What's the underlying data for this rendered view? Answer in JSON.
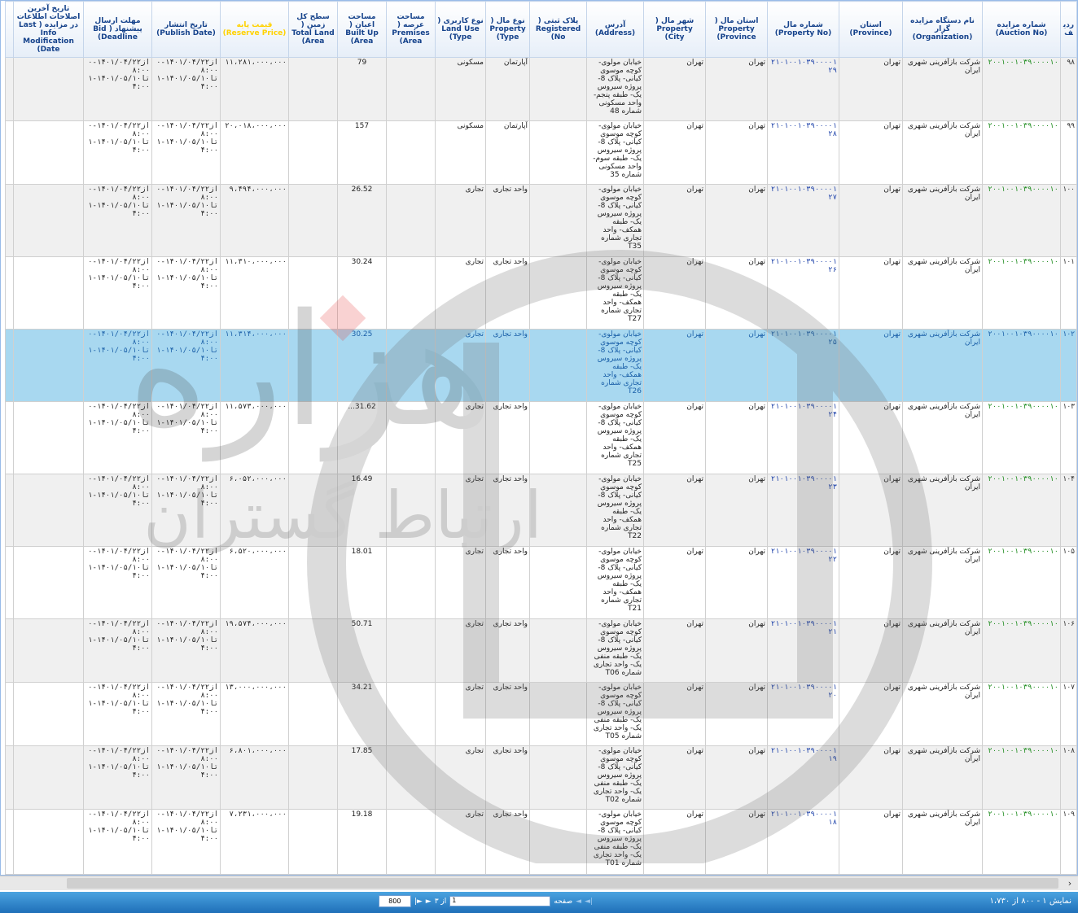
{
  "columns": [
    {
      "key": "rn",
      "label": "ردیف",
      "w": 20
    },
    {
      "key": "auction_no",
      "label": "شماره مزایده (Auction No)",
      "w": 96
    },
    {
      "key": "organization",
      "label": "نام دستگاه مزایده گزار (Organization)",
      "w": 98
    },
    {
      "key": "province",
      "label": "استان (Province)",
      "w": 78
    },
    {
      "key": "property_no",
      "label": "شماره مال (Property No)",
      "w": 88
    },
    {
      "key": "property_province",
      "label": "استان مال ( Property Province)",
      "w": 76
    },
    {
      "key": "property_city",
      "label": "شهر مال ( Property City)",
      "w": 76
    },
    {
      "key": "address",
      "label": "آدرس (Address)",
      "w": 70
    },
    {
      "key": "registered_no",
      "label": "پلاک ثبتی ( Registered No)",
      "w": 70
    },
    {
      "key": "property_type",
      "label": "نوع مال ( Property Type)",
      "w": 54
    },
    {
      "key": "land_use",
      "label": "نوع کاربری ( Land Use Type)",
      "w": 62
    },
    {
      "key": "premises_area",
      "label": "مساحت عرصه ( Premises Area)",
      "w": 60
    },
    {
      "key": "built_up_area",
      "label": "مساحت اعیان ( Built Up Area)",
      "w": 60
    },
    {
      "key": "land_area",
      "label": "سطح کل زمین ( Total Land Area)",
      "w": 60
    },
    {
      "key": "reserve_price",
      "label": "قیمت پایه (Reserve Price)",
      "w": 84
    },
    {
      "key": "publish_date",
      "label": "تاریخ انتشار (Publish Date)",
      "w": 84
    },
    {
      "key": "deadline",
      "label": "مهلت ارسال پیشنهاد ( Bid Deadline)",
      "w": 84
    },
    {
      "key": "last_mod",
      "label": "تاریخ آخرین اصلاحات اطلاعات در مزایده ( Last Info Modification Date)",
      "w": 86
    },
    {
      "key": "extra",
      "label": "",
      "w": 10
    }
  ],
  "rows": [
    {
      "rn": "۹۸",
      "auction_no": "۲۰۰۱۰۰۱۰۳۹۰۰۰۰۱۰",
      "organization": "شرکت بازآفرینی شهری ایران",
      "province": "تهران",
      "property_no": "۲۱۰۱۰۰۱۰۳۹۰۰۰۰۱۲۹",
      "property_province": "تهران",
      "property_city": "تهران",
      "address": "خیابان مولوی- کوچه موسوی کیانی- پلاک 8- پروژه سیروس یک- طبقه پنجم- واحد مسکونی شماره 48",
      "registered_no": "",
      "property_type": "آپارتمان",
      "land_use": "مسکونی",
      "premises_area": "",
      "built_up_area": "79",
      "land_area": "",
      "reserve_price": "۱۱،۲۸۱،۰۰۰،۰۰۰",
      "publish_date": "از۱۴۰۱/۰۴/۲۲-۰۸:۰۰ تا۱۴۰۱/۰۵/۱۰-۱۴:۰۰",
      "deadline": "از۱۴۰۱/۰۴/۲۲-۰۸:۰۰ تا۱۴۰۱/۰۵/۱۰-۱۴:۰۰",
      "last_mod": "",
      "h": 78
    },
    {
      "rn": "۹۹",
      "auction_no": "۲۰۰۱۰۰۱۰۳۹۰۰۰۰۱۰",
      "organization": "شرکت بازآفرینی شهری ایران",
      "province": "تهران",
      "property_no": "۲۱۰۱۰۰۱۰۳۹۰۰۰۰۱۲۸",
      "property_province": "تهران",
      "property_city": "تهران",
      "address": "خیابان مولوی- کوچه موسوی کیانی- پلاک 8- پروژه سیروس یک- طبقه سوم- واحد مسکونی شماره 35",
      "registered_no": "",
      "property_type": "آپارتمان",
      "land_use": "مسکونی",
      "premises_area": "",
      "built_up_area": "157",
      "land_area": "",
      "reserve_price": "۲۰،۰۱۸،۰۰۰،۰۰۰",
      "publish_date": "از۱۴۰۱/۰۴/۲۲-۰۸:۰۰ تا۱۴۰۱/۰۵/۱۰-۱۴:۰۰",
      "deadline": "از۱۴۰۱/۰۴/۲۲-۰۸:۰۰ تا۱۴۰۱/۰۵/۱۰-۱۴:۰۰",
      "last_mod": "",
      "h": 78
    },
    {
      "rn": "۱۰۰",
      "auction_no": "۲۰۰۱۰۰۱۰۳۹۰۰۰۰۱۰",
      "organization": "شرکت بازآفرینی شهری ایران",
      "province": "تهران",
      "property_no": "۲۱۰۱۰۰۱۰۳۹۰۰۰۰۱۲۷",
      "property_province": "تهران",
      "property_city": "تهران",
      "address": "خیابان مولوی- کوچه موسوی کیانی- پلاک 8- پروژه سیروس یک- طبقه همکف- واحد تجاری شماره T35",
      "registered_no": "",
      "property_type": "واحد تجاری",
      "land_use": "تجاری",
      "premises_area": "",
      "built_up_area": "26.52",
      "land_area": "",
      "reserve_price": "۹،۴۹۴،۰۰۰،۰۰۰",
      "publish_date": "از۱۴۰۱/۰۴/۲۲-۰۸:۰۰ تا۱۴۰۱/۰۵/۱۰-۱۴:۰۰",
      "deadline": "از۱۴۰۱/۰۴/۲۲-۰۸:۰۰ تا۱۴۰۱/۰۵/۱۰-۱۴:۰۰",
      "last_mod": "",
      "h": 89
    },
    {
      "rn": "۱۰۱",
      "auction_no": "۲۰۰۱۰۰۱۰۳۹۰۰۰۰۱۰",
      "organization": "شرکت بازآفرینی شهری ایران",
      "province": "تهران",
      "property_no": "۲۱۰۱۰۰۱۰۳۹۰۰۰۰۱۲۶",
      "property_province": "تهران",
      "property_city": "تهران",
      "address": "خیابان مولوی- کوچه موسوی کیانی- پلاک 8- پروژه سیروس یک- طبقه همکف- واحد تجاری شماره T27",
      "registered_no": "",
      "property_type": "واحد تجاری",
      "land_use": "تجاری",
      "premises_area": "",
      "built_up_area": "30.24",
      "land_area": "",
      "reserve_price": "۱۱،۳۱۰،۰۰۰،۰۰۰",
      "publish_date": "از۱۴۰۱/۰۴/۲۲-۰۸:۰۰ تا۱۴۰۱/۰۵/۱۰-۱۴:۰۰",
      "deadline": "از۱۴۰۱/۰۴/۲۲-۰۸:۰۰ تا۱۴۰۱/۰۵/۱۰-۱۴:۰۰",
      "last_mod": "",
      "h": 89
    },
    {
      "rn": "۱۰۲",
      "auction_no": "۲۰۰۱۰۰۱۰۳۹۰۰۰۰۱۰",
      "organization": "شرکت بازآفرینی شهری ایران",
      "province": "تهران",
      "property_no": "۲۱۰۱۰۰۱۰۳۹۰۰۰۰۱۲۵",
      "property_province": "تهران",
      "property_city": "تهران",
      "address": "خیابان مولوی- کوچه موسوی کیانی- پلاک 8- پروژه سیروس یک- طبقه همکف- واحد تجاری شماره T26",
      "registered_no": "",
      "property_type": "واحد تجاری",
      "land_use": "تجاری",
      "premises_area": "",
      "built_up_area": "30.25",
      "land_area": "",
      "reserve_price": "۱۱،۳۱۴،۰۰۰،۰۰۰",
      "publish_date": "از۱۴۰۱/۰۴/۲۲-۰۸:۰۰ تا۱۴۰۱/۰۵/۱۰-۱۴:۰۰",
      "deadline": "از۱۴۰۱/۰۴/۲۲-۰۸:۰۰ تا۱۴۰۱/۰۵/۱۰-۱۴:۰۰",
      "last_mod": "",
      "h": 89,
      "selected": true
    },
    {
      "rn": "۱۰۳",
      "auction_no": "۲۰۰۱۰۰۱۰۳۹۰۰۰۰۱۰",
      "organization": "شرکت بازآفرینی شهری ایران",
      "province": "تهران",
      "property_no": "۲۱۰۱۰۰۱۰۳۹۰۰۰۰۱۲۴",
      "property_province": "تهران",
      "property_city": "تهران",
      "address": "خیابان مولوی- کوچه موسوی کیانی- پلاک 8- پروژه سیروس یک- طبقه همکف- واحد تجاری شماره T25",
      "registered_no": "",
      "property_type": "واحد تجاری",
      "land_use": "تجاری",
      "premises_area": "",
      "built_up_area": "31.62...",
      "land_area": "",
      "reserve_price": "۱۱،۵۷۳،۰۰۰،۰۰۰",
      "publish_date": "از۱۴۰۱/۰۴/۲۲-۰۸:۰۰ تا۱۴۰۱/۰۵/۱۰-۱۴:۰۰",
      "deadline": "از۱۴۰۱/۰۴/۲۲-۰۸:۰۰ تا۱۴۰۱/۰۵/۱۰-۱۴:۰۰",
      "last_mod": "",
      "h": 89
    },
    {
      "rn": "۱۰۴",
      "auction_no": "۲۰۰۱۰۰۱۰۳۹۰۰۰۰۱۰",
      "organization": "شرکت بازآفرینی شهری ایران",
      "province": "تهران",
      "property_no": "۲۱۰۱۰۰۱۰۳۹۰۰۰۰۱۲۳",
      "property_province": "تهران",
      "property_city": "تهران",
      "address": "خیابان مولوی- کوچه موسوی کیانی- پلاک 8- پروژه سیروس یک- طبقه همکف- واحد تجاری شماره T22",
      "registered_no": "",
      "property_type": "واحد تجاری",
      "land_use": "تجاری",
      "premises_area": "",
      "built_up_area": "16.49",
      "land_area": "",
      "reserve_price": "۶،۰۵۲،۰۰۰،۰۰۰",
      "publish_date": "از۱۴۰۱/۰۴/۲۲-۰۸:۰۰ تا۱۴۰۱/۰۵/۱۰-۱۴:۰۰",
      "deadline": "از۱۴۰۱/۰۴/۲۲-۰۸:۰۰ تا۱۴۰۱/۰۵/۱۰-۱۴:۰۰",
      "last_mod": "",
      "h": 89
    },
    {
      "rn": "۱۰۵",
      "auction_no": "۲۰۰۱۰۰۱۰۳۹۰۰۰۰۱۰",
      "organization": "شرکت بازآفرینی شهری ایران",
      "province": "تهران",
      "property_no": "۲۱۰۱۰۰۱۰۳۹۰۰۰۰۱۲۲",
      "property_province": "تهران",
      "property_city": "تهران",
      "address": "خیابان مولوی- کوچه موسوی کیانی- پلاک 8- پروژه سیروس یک- طبقه همکف- واحد تجاری شماره T21",
      "registered_no": "",
      "property_type": "واحد تجاری",
      "land_use": "تجاری",
      "premises_area": "",
      "built_up_area": "18.01",
      "land_area": "",
      "reserve_price": "۶،۵۲۰،۰۰۰،۰۰۰",
      "publish_date": "از۱۴۰۱/۰۴/۲۲-۰۸:۰۰ تا۱۴۰۱/۰۵/۱۰-۱۴:۰۰",
      "deadline": "از۱۴۰۱/۰۴/۲۲-۰۸:۰۰ تا۱۴۰۱/۰۵/۱۰-۱۴:۰۰",
      "last_mod": "",
      "h": 89
    },
    {
      "rn": "۱۰۶",
      "auction_no": "۲۰۰۱۰۰۱۰۳۹۰۰۰۰۱۰",
      "organization": "شرکت بازآفرینی شهری ایران",
      "province": "تهران",
      "property_no": "۲۱۰۱۰۰۱۰۳۹۰۰۰۰۱۲۱",
      "property_province": "تهران",
      "property_city": "تهران",
      "address": "خیابان مولوی- کوچه موسوی کیانی- پلاک 8- پروژه سیروس یک- طبقه منفی یک- واحد تجاری شماره T06",
      "registered_no": "",
      "property_type": "واحد تجاری",
      "land_use": "تجاری",
      "premises_area": "",
      "built_up_area": "50.71",
      "land_area": "",
      "reserve_price": "۱۹،۵۷۴،۰۰۰،۰۰۰",
      "publish_date": "از۱۴۰۱/۰۴/۲۲-۰۸:۰۰ تا۱۴۰۱/۰۵/۱۰-۱۴:۰۰",
      "deadline": "از۱۴۰۱/۰۴/۲۲-۰۸:۰۰ تا۱۴۰۱/۰۵/۱۰-۱۴:۰۰",
      "last_mod": "",
      "h": 78
    },
    {
      "rn": "۱۰۷",
      "auction_no": "۲۰۰۱۰۰۱۰۳۹۰۰۰۰۱۰",
      "organization": "شرکت بازآفرینی شهری ایران",
      "province": "تهران",
      "property_no": "۲۱۰۱۰۰۱۰۳۹۰۰۰۰۱۲۰",
      "property_province": "تهران",
      "property_city": "تهران",
      "address": "خیابان مولوی- کوچه موسوی کیانی- پلاک 8- پروژه سیروس یک- طبقه منفی یک- واحد تجاری شماره T05",
      "registered_no": "",
      "property_type": "واحد تجاری",
      "land_use": "تجاری",
      "premises_area": "",
      "built_up_area": "34.21",
      "land_area": "",
      "reserve_price": "۱۳،۰۰۰،۰۰۰،۰۰۰",
      "publish_date": "از۱۴۰۱/۰۴/۲۲-۰۸:۰۰ تا۱۴۰۱/۰۵/۱۰-۱۴:۰۰",
      "deadline": "از۱۴۰۱/۰۴/۲۲-۰۸:۰۰ تا۱۴۰۱/۰۵/۱۰-۱۴:۰۰",
      "last_mod": "",
      "h": 78
    },
    {
      "rn": "۱۰۸",
      "auction_no": "۲۰۰۱۰۰۱۰۳۹۰۰۰۰۱۰",
      "organization": "شرکت بازآفرینی شهری ایران",
      "province": "تهران",
      "property_no": "۲۱۰۱۰۰۱۰۳۹۰۰۰۰۱۱۹",
      "property_province": "تهران",
      "property_city": "تهران",
      "address": "خیابان مولوی- کوچه موسوی کیانی- پلاک 8- پروژه سیروس یک- طبقه منفی یک- واحد تجاری شماره T02",
      "registered_no": "",
      "property_type": "واحد تجاری",
      "land_use": "تجاری",
      "premises_area": "",
      "built_up_area": "17.85",
      "land_area": "",
      "reserve_price": "۶،۸۰۱،۰۰۰،۰۰۰",
      "publish_date": "از۱۴۰۱/۰۴/۲۲-۰۸:۰۰ تا۱۴۰۱/۰۵/۱۰-۱۴:۰۰",
      "deadline": "از۱۴۰۱/۰۴/۲۲-۰۸:۰۰ تا۱۴۰۱/۰۵/۱۰-۱۴:۰۰",
      "last_mod": "",
      "h": 78
    },
    {
      "rn": "۱۰۹",
      "auction_no": "۲۰۰۱۰۰۱۰۳۹۰۰۰۰۱۰",
      "organization": "شرکت بازآفرینی شهری ایران",
      "province": "تهران",
      "property_no": "۲۱۰۱۰۰۱۰۳۹۰۰۰۰۱۱۸",
      "property_province": "تهران",
      "property_city": "تهران",
      "address": "خیابان مولوی- کوچه موسوی کیانی- پلاک 8- پروژه سیروس یک- طبقه منفی یک- واحد تجاری شماره T01",
      "registered_no": "",
      "property_type": "واحد تجاری",
      "land_use": "تجاری",
      "premises_area": "",
      "built_up_area": "19.18",
      "land_area": "",
      "reserve_price": "۷،۲۳۱،۰۰۰،۰۰۰",
      "publish_date": "از۱۴۰۱/۰۴/۲۲-۰۸:۰۰ تا۱۴۰۱/۰۵/۱۰-۱۴:۰۰",
      "deadline": "از۱۴۰۱/۰۴/۲۲-۰۸:۰۰ تا۱۴۰۱/۰۵/۱۰-۱۴:۰۰",
      "last_mod": "",
      "h": 80
    }
  ],
  "watermark": {
    "text_main": "هزاره",
    "text_sub": "ارتباط گستران",
    "icon": "hezareh-logo-icon"
  },
  "pager": {
    "info": "نمایش ۱ - ۸۰۰ از ۱،۷۳۰",
    "page_label": "صفحه",
    "page_value": "1",
    "of_label": "از ۳",
    "page_size": "800",
    "first_icon": "first-page-icon",
    "prev_icon": "prev-page-icon",
    "next_icon": "next-page-icon",
    "last_icon": "last-page-icon"
  },
  "scroll": {
    "right_arrow": "›"
  },
  "colors": {
    "selected_row": "#a8d8f0",
    "header_text": "#15428b",
    "reserve_header": "#ffd200",
    "pager_bg": "#2a7fc8",
    "auction_no": "#1a8a1a",
    "property_no": "#1a3fa8"
  }
}
